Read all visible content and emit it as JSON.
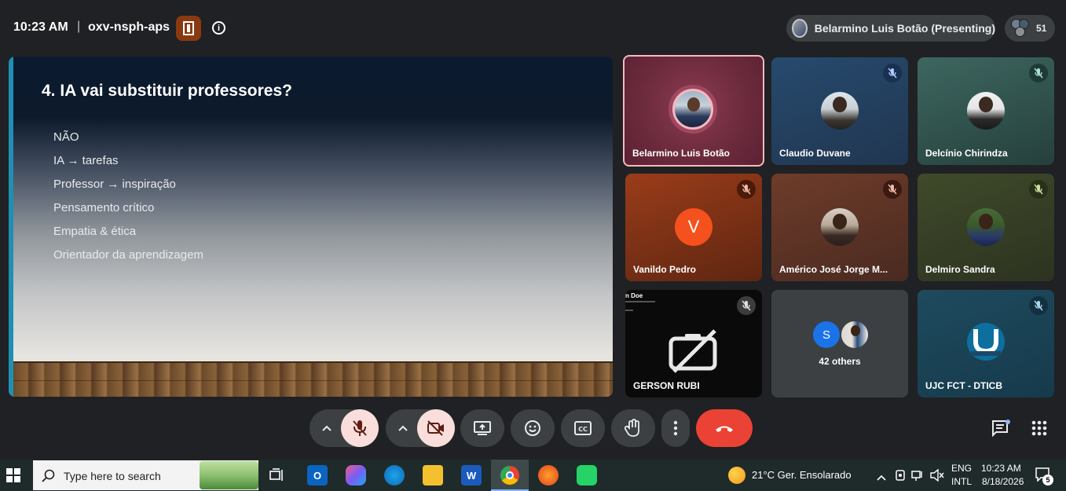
{
  "topbar": {
    "time": "10:23 AM",
    "separator": "|",
    "meeting_code": "oxv-nsph-aps",
    "presenting_label": "Belarmino Luis Botão (Presenting)",
    "participant_count": "51"
  },
  "slide": {
    "title": "4. IA vai substituir professores?",
    "bullets": [
      "NÃO",
      "IA → tarefas",
      "Professor → inspiração",
      "Pensamento crítico",
      "Empatia & ética",
      "Orientador da aprendizagem"
    ]
  },
  "participants": [
    {
      "name": "Belarmino Luis Botão",
      "muted": false,
      "speaking": true
    },
    {
      "name": "Claudio Duvane",
      "muted": true
    },
    {
      "name": "Delcínio Chirindza",
      "muted": true
    },
    {
      "name": "Vanildo Pedro",
      "muted": true,
      "initial": "V"
    },
    {
      "name": "Américo José Jorge M...",
      "muted": true
    },
    {
      "name": "Delmiro Sandra",
      "muted": true
    },
    {
      "name": "GERSON RUBI",
      "muted": true,
      "overlay_name": "n Doe"
    },
    {
      "name": "42 others",
      "initial": "S"
    },
    {
      "name": "UJC FCT - DTICB",
      "muted": true
    }
  ],
  "colors": {
    "accent": "#1f8fb3",
    "hangup": "#ea4335",
    "muted_bg": "#f9dedc",
    "speaking_border": "#f6b8c0"
  },
  "taskbar": {
    "search_placeholder": "Type here to search",
    "weather": "21°C  Ger. Ensolarado",
    "lang_top": "ENG",
    "lang_bottom": "INTL",
    "clock_time": "10:23 AM",
    "clock_date": "8/18/2026",
    "notification_count": "5",
    "word_label": "W"
  }
}
